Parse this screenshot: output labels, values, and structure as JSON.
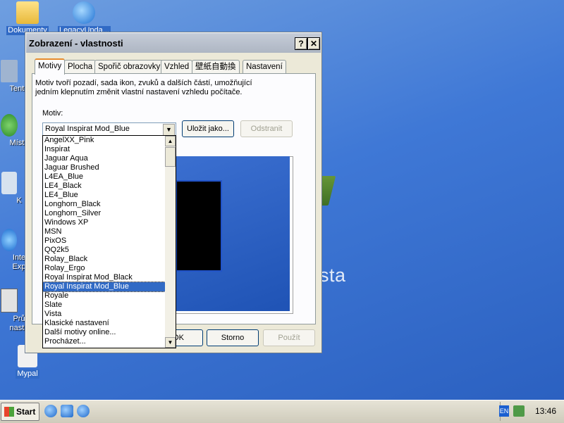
{
  "desktop": {
    "watermark_fragment": "sta",
    "icons": [
      {
        "label": "Dokumenty",
        "selected": true
      },
      {
        "label": "LegacyUpda...",
        "selected": true
      },
      {
        "label": "Tento"
      },
      {
        "label": "Místa"
      },
      {
        "label": "K"
      },
      {
        "label": "Inte"
      },
      {
        "label": "Exp"
      },
      {
        "label": "Prů"
      },
      {
        "label": "nasta"
      },
      {
        "label": "Mypal",
        "selected": true
      }
    ]
  },
  "window": {
    "title": "Zobrazení - vlastnosti",
    "help_label": "?",
    "close_label": "✕",
    "tabs": [
      "Motivy",
      "Plocha",
      "Spořič obrazovky",
      "Vzhled",
      "壁紙自動換",
      "Nastavení"
    ],
    "active_tab": "Motivy",
    "description": "Motiv tvoří pozadí, sada ikon, zvuků a dalších částí, umožňující jedním klepnutím změnit vlastní nastavení vzhledu počítače.",
    "theme_label": "Motiv:",
    "selected_theme": "Royal Inspirat Mod_Blue",
    "save_as_label": "Uložit jako...",
    "delete_label": "Odstranit",
    "ok_label": "OK",
    "cancel_label": "Storno",
    "apply_label": "Použít",
    "dropdown_items": [
      "AngelXX_Pink",
      "Inspirat",
      "Jaguar Aqua",
      "Jaguar Brushed",
      "L4EA_Blue",
      "LE4_Black",
      "LE4_Blue",
      "Longhorn_Black",
      "Longhorn_Silver",
      "Windows XP",
      "MSN",
      "PixOS",
      "QQ2k5",
      "Rolay_Black",
      "Rolay_Ergo",
      "Royal Inspirat Mod_Black",
      "Royal Inspirat Mod_Blue",
      "Royale",
      "Slate",
      "Vista",
      "Klasické nastavení",
      "Další motivy online...",
      "Procházet..."
    ]
  },
  "taskbar": {
    "start_label": "Start",
    "lang": "EN",
    "clock": "13:46"
  }
}
